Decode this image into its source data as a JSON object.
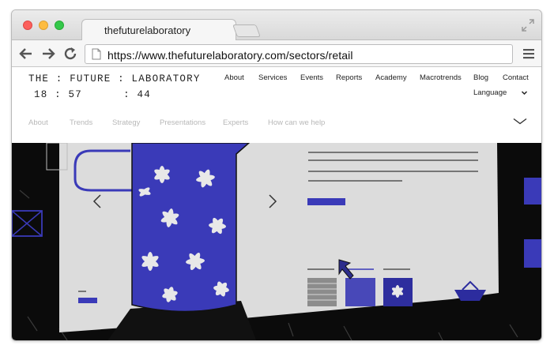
{
  "browser": {
    "tab_title": "thefuturelaboratory",
    "url": "https://www.thefuturelaboratory.com/sectors/retail"
  },
  "site": {
    "logo": "THE : FUTURE : LABORATORY",
    "clock": {
      "hours": "18",
      "minutes": "57",
      "seconds": "44"
    },
    "nav": [
      "About",
      "Services",
      "Events",
      "Reports",
      "Academy",
      "Macrotrends",
      "Blog",
      "Contact"
    ],
    "language_label": "Language",
    "subnav": [
      "About",
      "Trends",
      "Strategy",
      "Presentations",
      "Experts",
      "How can we help"
    ]
  },
  "colors": {
    "accent_blue": "#3a3ab8",
    "hero_bg": "#0b0b0b",
    "paper": "#dcdcdc"
  },
  "icons": [
    "back-arrow-icon",
    "forward-arrow-icon",
    "reload-icon",
    "page-icon",
    "menu-icon",
    "expand-icon",
    "chevron-down-icon",
    "carousel-prev-icon",
    "carousel-next-icon",
    "cursor-icon",
    "basket-icon"
  ]
}
